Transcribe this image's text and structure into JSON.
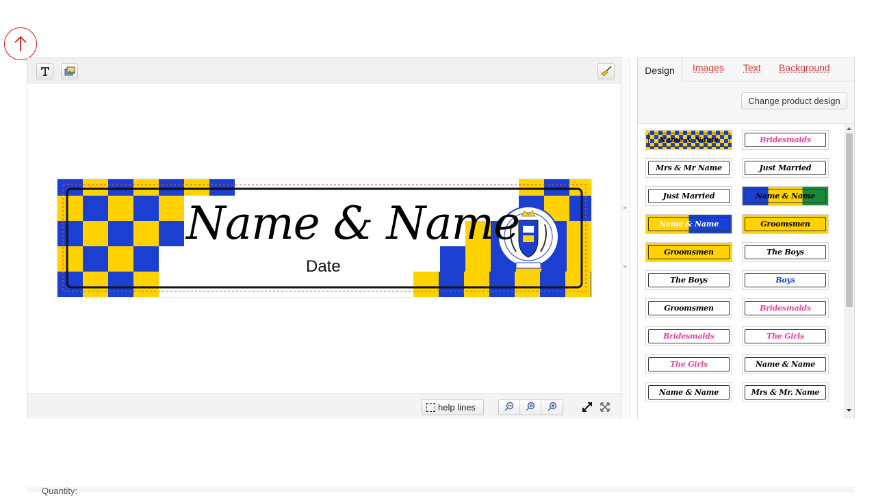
{
  "scroll_top": {
    "icon": "arrow-up-circle-icon",
    "color": "#d42020"
  },
  "editor": {
    "toolbar": {
      "add_text_icon": "text-tool-icon",
      "add_image_icon": "image-tool-icon",
      "clear_icon": "broom-icon"
    },
    "plate": {
      "main_text": "Name & Name",
      "date_text": "Date",
      "check_colors": [
        "#1a3fd1",
        "#ffd200"
      ],
      "crest_icon": "county-crest-icon"
    },
    "bottombar": {
      "help_lines_label": "help lines",
      "zoom_out_icon": "zoom-out-icon",
      "zoom_reset_icon": "zoom-reset-icon",
      "zoom_in_icon": "zoom-in-icon",
      "fit_icon": "fit-screen-icon",
      "fullscreen_icon": "fullscreen-icon"
    }
  },
  "splitter": {
    "upper": "»",
    "lower": "»"
  },
  "panel": {
    "tabs": [
      {
        "label": "Design",
        "active": true
      },
      {
        "label": "Images",
        "active": false
      },
      {
        "label": "Text",
        "active": false
      },
      {
        "label": "Background",
        "active": false
      }
    ],
    "change_button": "Change product design",
    "designs": [
      {
        "label": "Name & Name",
        "bg": "checks",
        "color": "#000"
      },
      {
        "label": "Bridesmaids",
        "bg": "white",
        "color": "#e0479e"
      },
      {
        "label": "Mrs & Mr Name",
        "bg": "white",
        "color": "#000"
      },
      {
        "label": "Just Married",
        "bg": "white",
        "color": "#000"
      },
      {
        "label": "Just Married",
        "bg": "white",
        "color": "#000"
      },
      {
        "label": "Name & Name",
        "bg": "checks-green",
        "color": "#000"
      },
      {
        "label": "Name & Name",
        "bg": "yellow-blue",
        "color": "#fff"
      },
      {
        "label": "Groomsmen",
        "bg": "yellow",
        "color": "#000"
      },
      {
        "label": "Groomsmen",
        "bg": "yellow",
        "color": "#000"
      },
      {
        "label": "The Boys",
        "bg": "white",
        "color": "#000"
      },
      {
        "label": "The Boys",
        "bg": "white",
        "color": "#000"
      },
      {
        "label": "Boys",
        "bg": "white",
        "color": "#1a3fd1"
      },
      {
        "label": "Groomsmen",
        "bg": "white",
        "color": "#000"
      },
      {
        "label": "Bridesmaids",
        "bg": "white",
        "color": "#e0479e"
      },
      {
        "label": "Bridesmaids",
        "bg": "white",
        "color": "#e0479e"
      },
      {
        "label": "The Girls",
        "bg": "white",
        "color": "#e0479e"
      },
      {
        "label": "The Girls",
        "bg": "white",
        "color": "#e0479e"
      },
      {
        "label": "Name & Name",
        "bg": "white",
        "color": "#000"
      },
      {
        "label": "Name & Name",
        "bg": "white",
        "color": "#000"
      },
      {
        "label": "Mrs & Mr. Name",
        "bg": "white",
        "color": "#000"
      }
    ]
  },
  "quantity_label": "Quantity:"
}
